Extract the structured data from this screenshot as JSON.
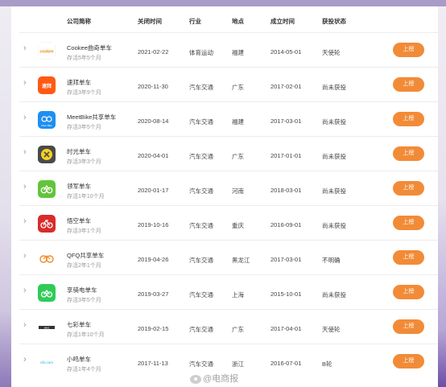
{
  "header": {
    "name": "公司简称",
    "close_time": "关闭时间",
    "industry": "行业",
    "location": "地点",
    "founded": "成立时间",
    "funding": "获投状态"
  },
  "button_label": "上榜",
  "rows": [
    {
      "name": "Cookee曲奇单车",
      "survival": "存活5年5个月",
      "close": "2021-02-22",
      "industry": "体育运动",
      "loc": "福建",
      "founded": "2014-05-01",
      "funding": "天使轮",
      "logo": "cookee-logo",
      "logo_text": "cookee"
    },
    {
      "name": "速拜单车",
      "survival": "存活3年9个月",
      "close": "2020-11-30",
      "industry": "汽车交通",
      "loc": "广东",
      "founded": "2017-02-01",
      "funding": "尚未获投",
      "logo": "subai-logo",
      "logo_text": "速拜"
    },
    {
      "name": "MeetBike共享单车",
      "survival": "存活3年5个月",
      "close": "2020-08-14",
      "industry": "汽车交通",
      "loc": "福建",
      "founded": "2017-03-01",
      "funding": "尚未获投",
      "logo": "meetbike-logo",
      "logo_text": "Meet Bike"
    },
    {
      "name": "时光单车",
      "survival": "存活3年3个月",
      "close": "2020-04-01",
      "industry": "汽车交通",
      "loc": "广东",
      "founded": "2017-01-01",
      "funding": "尚未获投",
      "logo": "shiguang-logo",
      "logo_text": ""
    },
    {
      "name": "领军单车",
      "survival": "存活1年10个月",
      "close": "2020-01-17",
      "industry": "汽车交通",
      "loc": "河南",
      "founded": "2018-03-01",
      "funding": "尚未获投",
      "logo": "lingjun-logo",
      "logo_text": ""
    },
    {
      "name": "悟空单车",
      "survival": "存活3年1个月",
      "close": "2019-10-16",
      "industry": "汽车交通",
      "loc": "重庆",
      "founded": "2016-09-01",
      "funding": "尚未获投",
      "logo": "wukong-logo",
      "logo_text": ""
    },
    {
      "name": "QFQ共享单车",
      "survival": "存活2年1个月",
      "close": "2019-04-26",
      "industry": "汽车交通",
      "loc": "黑龙江",
      "founded": "2017-03-01",
      "funding": "不明确",
      "logo": "qfq-logo",
      "logo_text": ""
    },
    {
      "name": "享骑电单车",
      "survival": "存活3年5个月",
      "close": "2019-03-27",
      "industry": "汽车交通",
      "loc": "上海",
      "founded": "2015-10-01",
      "funding": "尚未获投",
      "logo": "xiangqi-logo",
      "logo_text": ""
    },
    {
      "name": "七彩单车",
      "survival": "存活1年10个月",
      "close": "2019-02-15",
      "industry": "汽车交通",
      "loc": "广东",
      "founded": "2017-04-01",
      "funding": "天使轮",
      "logo": "qicai-logo",
      "logo_text": "BIKE"
    },
    {
      "name": "小鸣单车",
      "survival": "存活1年4个月",
      "close": "2017-11-13",
      "industry": "汽车交通",
      "loc": "浙江",
      "founded": "2016-07-01",
      "funding": "B轮",
      "logo": "xiaoming-logo",
      "logo_text": "ofo.com"
    }
  ],
  "watermark": "@电商报"
}
